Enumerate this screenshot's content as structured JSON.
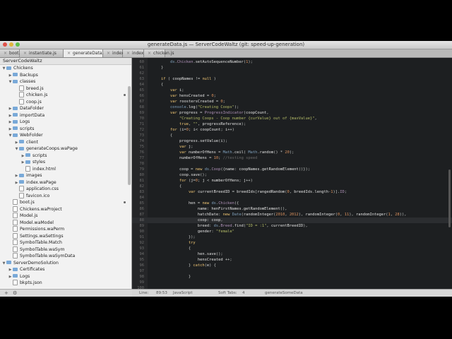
{
  "window": {
    "title": "generateData.js — ServerCodeWaltz (git: speed-up-generation)"
  },
  "tabs": [
    {
      "label": "boot.js"
    },
    {
      "label": "instantiate.js"
    },
    {
      "label": "generateData.js"
    },
    {
      "label": "index.js"
    },
    {
      "label": "index.js"
    },
    {
      "label": "chicken.js"
    }
  ],
  "sidebar": {
    "header": "ServerCodeWaltz",
    "items": [
      {
        "label": "Chickens",
        "type": "folder",
        "expanded": true,
        "depth": 0
      },
      {
        "label": "Backups",
        "type": "folder",
        "expanded": false,
        "depth": 1
      },
      {
        "label": "classes",
        "type": "folder",
        "expanded": true,
        "depth": 1
      },
      {
        "label": "breed.js",
        "type": "file",
        "depth": 2
      },
      {
        "label": "chicken.js",
        "type": "file",
        "depth": 2,
        "modified": true
      },
      {
        "label": "coop.js",
        "type": "file",
        "depth": 2
      },
      {
        "label": "DataFolder",
        "type": "folder",
        "expanded": false,
        "depth": 1
      },
      {
        "label": "importData",
        "type": "folder",
        "expanded": false,
        "depth": 1
      },
      {
        "label": "Logs",
        "type": "folder",
        "expanded": false,
        "depth": 1
      },
      {
        "label": "scripts",
        "type": "folder",
        "expanded": false,
        "depth": 1
      },
      {
        "label": "WebFolder",
        "type": "folder",
        "expanded": true,
        "depth": 1
      },
      {
        "label": "client",
        "type": "folder",
        "expanded": false,
        "depth": 2
      },
      {
        "label": "generateCoops.waPage",
        "type": "folder",
        "expanded": true,
        "depth": 2
      },
      {
        "label": "scripts",
        "type": "folder",
        "expanded": false,
        "depth": 3
      },
      {
        "label": "styles",
        "type": "folder",
        "expanded": false,
        "depth": 3
      },
      {
        "label": "index.html",
        "type": "file",
        "depth": 3
      },
      {
        "label": "images",
        "type": "folder",
        "expanded": false,
        "depth": 2
      },
      {
        "label": "index.waPage",
        "type": "folder",
        "expanded": false,
        "depth": 2
      },
      {
        "label": "application.css",
        "type": "file",
        "depth": 2
      },
      {
        "label": "favicon.ico",
        "type": "file",
        "depth": 2
      },
      {
        "label": "boot.js",
        "type": "file",
        "depth": 1,
        "modified": true
      },
      {
        "label": "Chickens.waProject",
        "type": "file",
        "depth": 1
      },
      {
        "label": "Model.js",
        "type": "file",
        "depth": 1
      },
      {
        "label": "Model.waModel",
        "type": "file",
        "depth": 1
      },
      {
        "label": "Permissions.waPerm",
        "type": "file",
        "depth": 1
      },
      {
        "label": "Settings.waSettings",
        "type": "file",
        "depth": 1
      },
      {
        "label": "SymbolTable.Match",
        "type": "file",
        "depth": 1
      },
      {
        "label": "SymbolTable.waSym",
        "type": "file",
        "depth": 1
      },
      {
        "label": "SymbolTable.waSymData",
        "type": "file",
        "depth": 1
      },
      {
        "label": "ServerDemoSolution",
        "type": "folder",
        "expanded": true,
        "depth": 0
      },
      {
        "label": "Certificates",
        "type": "folder",
        "expanded": false,
        "depth": 1
      },
      {
        "label": "Logs",
        "type": "folder",
        "expanded": false,
        "depth": 1
      },
      {
        "label": "bkpts.json",
        "type": "file",
        "depth": 1
      }
    ],
    "footer": {
      "add_label": "+",
      "settings_label": "⚙"
    }
  },
  "code": {
    "current_line": 88,
    "lines": [
      {
        "n": "60",
        "text": "        ds.Chicken.setAutoSequenceNumber(1);"
      },
      {
        "n": "61",
        "text": "    }"
      },
      {
        "n": "62",
        "text": ""
      },
      {
        "n": "63",
        "text": "    if ( coopNames != null )"
      },
      {
        "n": "64",
        "text": "    {"
      },
      {
        "n": "65",
        "text": "        var i;"
      },
      {
        "n": "66",
        "text": "        var hensCreated = 0;"
      },
      {
        "n": "67",
        "text": "        var roostersCreated = 0;"
      },
      {
        "n": "68",
        "text": "        console.log(\"Creating Coops\");"
      },
      {
        "n": "69",
        "text": "        var progress = ProgressIndicator(coopCount,"
      },
      {
        "n": "70",
        "text": "            \"Creating Coops - Coop number {curValue} out of {maxValue}\","
      },
      {
        "n": "71",
        "text": "            true, \"\", progressReference);"
      },
      {
        "n": "72",
        "text": "        for (i=0; i< coopCount; i++)"
      },
      {
        "n": "73",
        "text": "        {"
      },
      {
        "n": "74",
        "text": "            progress.setValue(i);"
      },
      {
        "n": "75",
        "text": "            var j;"
      },
      {
        "n": "76",
        "text": "            var numberOfHens = Math.ceil( Math.random() * 20);"
      },
      {
        "n": "77",
        "text": "            numberOfHens = 10; //testing speed"
      },
      {
        "n": "78",
        "text": ""
      },
      {
        "n": "79",
        "text": "            coop = new ds.Coop({name: coopNames.getRandomElement()});"
      },
      {
        "n": "80",
        "text": "            coop.save();"
      },
      {
        "n": "81",
        "text": "            for (j=0; j < numberOfHens; j++)"
      },
      {
        "n": "82",
        "text": "            {"
      },
      {
        "n": "83",
        "text": "                var currentBreedID = breedIds[rangedRandom(0, breedIds.length-1)].ID;"
      },
      {
        "n": "84",
        "text": ""
      },
      {
        "n": "85",
        "text": "                hen = new ds.Chicken({"
      },
      {
        "n": "86",
        "text": "                    name: henFirstNames.getRandomElement(),"
      },
      {
        "n": "87",
        "text": "                    hatchDate: new Date(randomInteger(2010, 2012), randomInteger(0, 11), randomInteger(1, 28)),"
      },
      {
        "n": "88",
        "text": "                    coop: coop,"
      },
      {
        "n": "89",
        "text": "                    breed: ds.Breed.find(\"ID = :1\", currentBreedID),"
      },
      {
        "n": "90",
        "text": "                    gender: \"female\""
      },
      {
        "n": "91",
        "text": "                });"
      },
      {
        "n": "92",
        "text": "                try"
      },
      {
        "n": "93",
        "text": "                {"
      },
      {
        "n": "94",
        "text": "                    hen.save();"
      },
      {
        "n": "95",
        "text": "                    hensCreated ++;"
      },
      {
        "n": "96",
        "text": "                } catch(e) {"
      },
      {
        "n": "97",
        "text": ""
      },
      {
        "n": "98",
        "text": "                }"
      },
      {
        "n": "99",
        "text": ""
      },
      {
        "n": "100",
        "text": ""
      }
    ]
  },
  "status": {
    "line_label": "Line:",
    "position": "89:53",
    "language": "JavaScript",
    "tabs": "Soft Tabs:",
    "tab_size": "4",
    "symbol": "generateSomeData"
  }
}
